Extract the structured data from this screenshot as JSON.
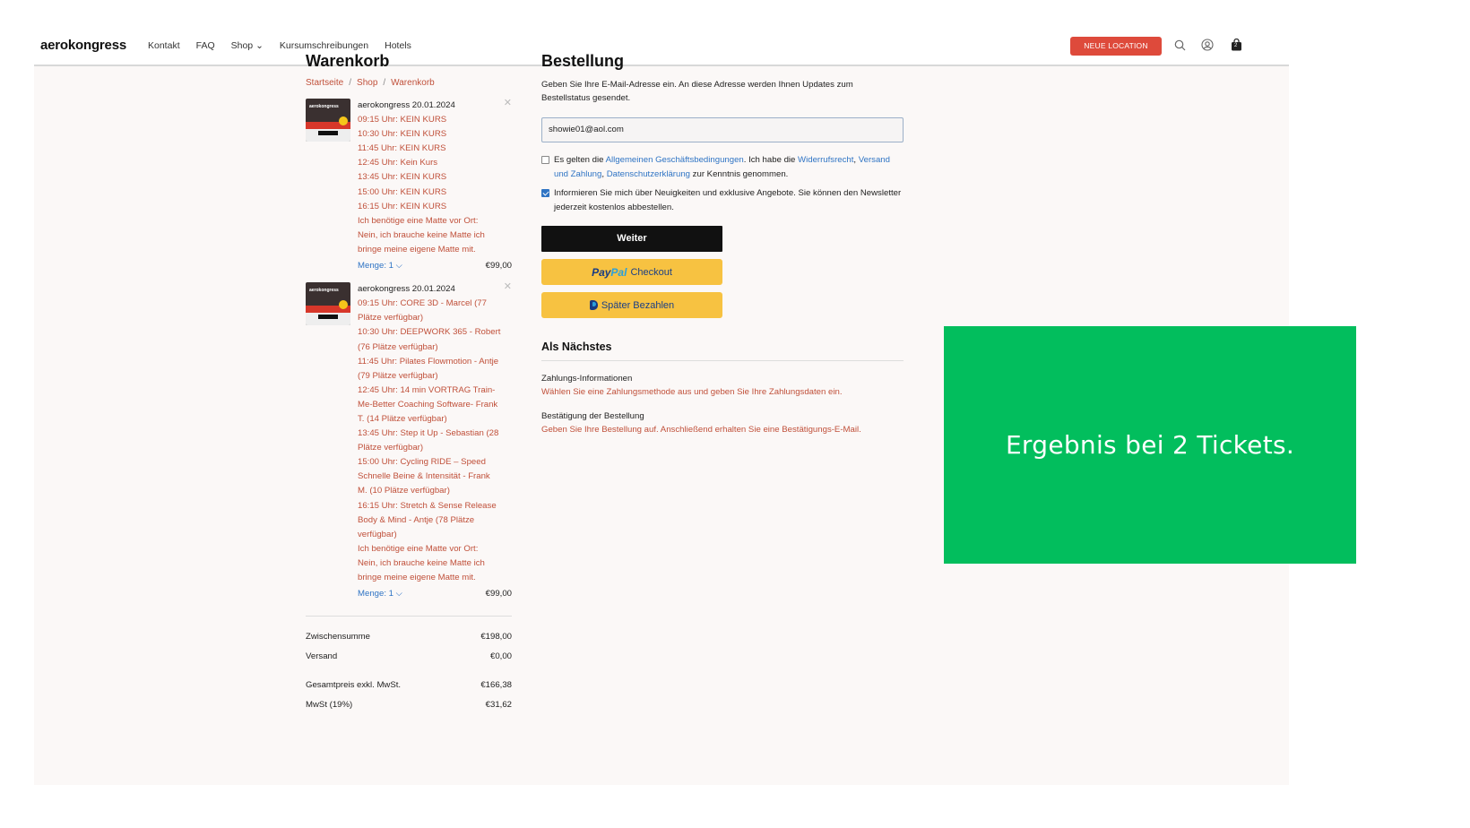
{
  "header": {
    "brand": "aerokongress",
    "nav": [
      "Kontakt",
      "FAQ",
      "Shop ⌄",
      "Kursumschreibungen",
      "Hotels"
    ],
    "cta_label": "NEUE LOCATION",
    "cart_count": "2",
    "icons": [
      "search-icon",
      "account-icon",
      "cart-bag-icon"
    ]
  },
  "cart": {
    "title": "Warenkorb",
    "breadcrumb": [
      "Startseite",
      "/",
      "Shop",
      "/",
      "Warenkorb"
    ],
    "items": [
      {
        "name": "aerokongress 20.01.2024",
        "thumb_title": "aerokongress",
        "options": [
          "09:15 Uhr: KEIN KURS",
          "10:30 Uhr: KEIN KURS",
          "11:45 Uhr: KEIN KURS",
          "12:45 Uhr: Kein Kurs",
          "13:45 Uhr: KEIN KURS",
          "15:00 Uhr: KEIN KURS",
          "16:15 Uhr: KEIN KURS",
          "Ich benötige eine Matte vor Ort:",
          "Nein, ich brauche keine Matte ich",
          "bringe meine eigene Matte mit."
        ],
        "qty_label": "Menge: 1 ⌵",
        "price": "€99,00"
      },
      {
        "name": "aerokongress 20.01.2024",
        "thumb_title": "aerokongress",
        "options": [
          "09:15 Uhr: CORE 3D - Marcel (77",
          "Plätze verfügbar)",
          "10:30 Uhr: DEEPWORK 365 - Robert",
          "(76 Plätze verfügbar)",
          "11:45 Uhr: Pilates Flowmotion - Antje",
          "(79 Plätze verfügbar)",
          "12:45 Uhr: 14 min VORTRAG Train-",
          "Me-Better Coaching Software- Frank",
          "T. (14 Plätze verfügbar)",
          "13:45 Uhr: Step it Up - Sebastian (28",
          "Plätze verfügbar)",
          "15:00 Uhr: Cycling RIDE – Speed",
          "Schnelle Beine & Intensität - Frank",
          "M. (10 Plätze verfügbar)",
          "16:15 Uhr: Stretch & Sense Release",
          "Body & Mind - Antje (78 Plätze",
          "verfügbar)",
          "Ich benötige eine Matte vor Ort:",
          "Nein, ich brauche keine Matte ich",
          "bringe meine eigene Matte mit."
        ],
        "qty_label": "Menge: 1 ⌵",
        "price": "€99,00"
      }
    ],
    "totals": {
      "subtotal_label": "Zwischensumme",
      "subtotal": "€198,00",
      "shipping_label": "Versand",
      "shipping": "€0,00",
      "net_label": "Gesamtpreis exkl. MwSt.",
      "net": "€166,38",
      "vat_label": "MwSt (19%)",
      "vat": "€31,62"
    }
  },
  "order": {
    "title": "Bestellung",
    "lead": "Geben Sie Ihre E-Mail-Adresse ein. An diese Adresse werden Ihnen Updates zum Bestellstatus gesendet.",
    "email_value": "showie01@aol.com",
    "terms": {
      "checked": false,
      "t1": "Es gelten die ",
      "l1": "Allgemeinen Geschäftsbedingungen",
      "t2": ". Ich habe die ",
      "l2": "Widerrufsrecht",
      "t3": ", ",
      "l3": "Versand und Zahlung",
      "t4": ", ",
      "l4": "Datenschutzerklärung",
      "t5": " zur Kenntnis genommen."
    },
    "newsletter": {
      "checked": true,
      "text": "Informieren Sie mich über Neuigkeiten und exklusive Angebote. Sie können den Newsletter jederzeit kostenlos abbestellen."
    },
    "continue_label": "Weiter",
    "paypal_word_a": "Pay",
    "paypal_word_b": "Pal",
    "paypal_checkout_label": "Checkout",
    "paylater_label": "Später Bezahlen",
    "next_title": "Als Nächstes",
    "steps": [
      {
        "title": "Zahlungs-Informationen",
        "desc": "Wählen Sie eine Zahlungsmethode aus und geben Sie Ihre Zahlungsdaten ein."
      },
      {
        "title": "Bestätigung der Bestellung",
        "desc": "Geben Sie Ihre Bestellung auf. Anschließend erhalten Sie eine Bestätigungs-E-Mail."
      }
    ]
  },
  "overlay": {
    "text": "Ergebnis bei 2 Tickets.",
    "color": "#02be5d"
  },
  "colors": {
    "accent_link": "#2f74c4",
    "option_text": "#c0503a",
    "cta_red": "#de4a3b",
    "paypal_yellow": "#f7c241"
  }
}
